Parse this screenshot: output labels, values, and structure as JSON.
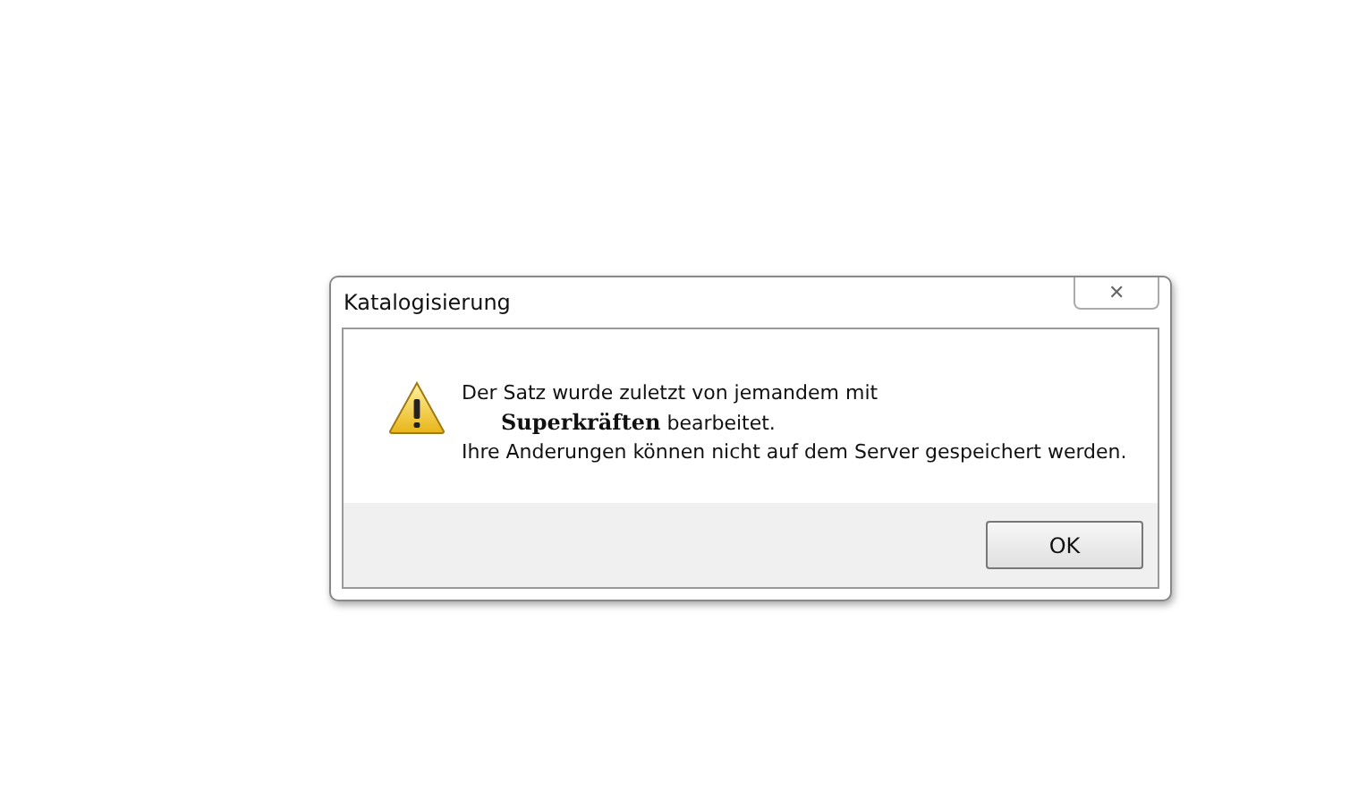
{
  "window": {
    "title": "Katalogisierung",
    "close": "✕"
  },
  "message": {
    "lines": [
      "Der Satz wurde zuletzt von jemandem mit",
      "**Superkräften** bearbeitet.",
      "Ihre Anderungen können nicht auf dem Server gespeichert werden."
    ]
  },
  "buttons": [
    "OK"
  ]
}
